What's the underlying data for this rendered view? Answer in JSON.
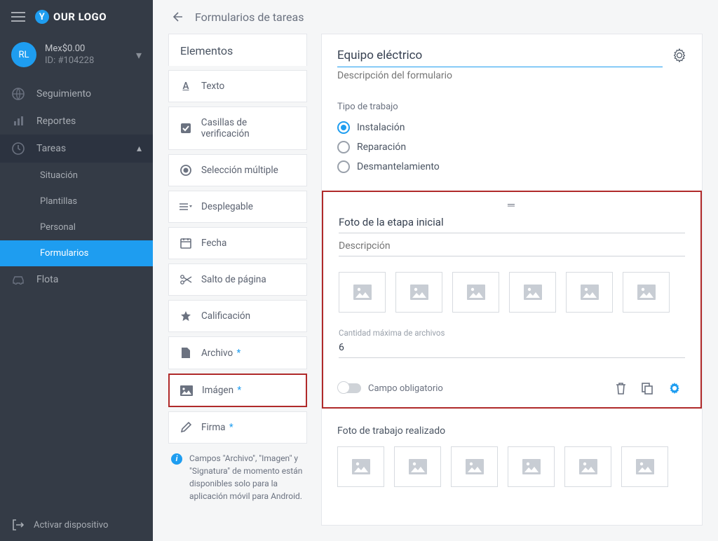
{
  "brand": {
    "initial": "Y",
    "rest": "OUR LOGO"
  },
  "user": {
    "initials": "RL",
    "balance": "Mex$0.00",
    "id": "ID: #104228"
  },
  "nav": {
    "seguimiento": "Seguimiento",
    "reportes": "Reportes",
    "tareas": "Tareas",
    "situacion": "Situación",
    "plantillas": "Plantillas",
    "personal": "Personal",
    "formularios": "Formularios",
    "flota": "Flota"
  },
  "footer": {
    "activar": "Activar dispositivo"
  },
  "topbar": {
    "title": "Formularios de tareas"
  },
  "elements": {
    "title": "Elementos",
    "items": {
      "texto": "Texto",
      "casillas": "Casillas de verificación",
      "seleccion": "Selección múltiple",
      "desplegable": "Desplegable",
      "fecha": "Fecha",
      "salto": "Salto de página",
      "calificacion": "Calificación",
      "archivo": "Archivo",
      "imagen": "Imágen",
      "firma": "Firma"
    },
    "note": "Campos \"Archivo\", \"Imagen\" y \"Signatura\" de momento están disponibles solo para la aplicación móvil para Android."
  },
  "form": {
    "title": "Equipo eléctrico",
    "desc_placeholder": "Descripción del formulario",
    "tipo_label": "Tipo de trabajo",
    "opts": [
      "Instalación",
      "Reparación",
      "Desmantelamiento"
    ],
    "block": {
      "title": "Foto de la etapa inicial",
      "desc_placeholder": "Descripción",
      "max_label": "Cantidad máxima de archivos",
      "max_value": "6",
      "required_label": "Campo obligatorio"
    },
    "block2_title": "Foto de trabajo realizado"
  }
}
